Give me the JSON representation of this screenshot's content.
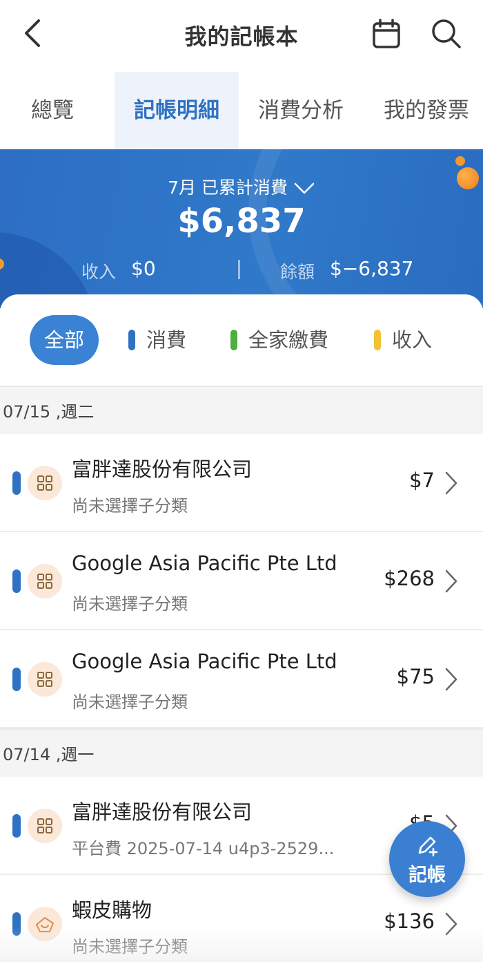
{
  "header": {
    "title": "我的記帳本",
    "back_icon": "chevron-left-icon",
    "calendar_icon": "calendar-icon",
    "search_icon": "search-icon"
  },
  "tabs": [
    {
      "label": "總覽",
      "active": false
    },
    {
      "label": "記帳明細",
      "active": true
    },
    {
      "label": "消費分析",
      "active": false
    },
    {
      "label": "我的發票",
      "active": false
    }
  ],
  "summary": {
    "month_label": "7月 已累計消費",
    "total": "$6,837",
    "income_label": "收入",
    "income_value": "$0",
    "balance_label": "餘額",
    "balance_value": "$−6,837"
  },
  "filters": {
    "all": "全部",
    "items": [
      {
        "label": "消費",
        "color": "#2f72c4"
      },
      {
        "label": "全家繳費",
        "color": "#4caf3f"
      },
      {
        "label": "收入",
        "color": "#f2c230"
      }
    ]
  },
  "groups": [
    {
      "date": "07/15 ,週二",
      "entries": [
        {
          "title": "富胖達股份有限公司",
          "sub": "尚未選擇子分類",
          "amount": "$7",
          "icon": "category-grid-icon"
        },
        {
          "title": "Google Asia Pacific Pte Ltd",
          "sub": "尚未選擇子分類",
          "amount": "$268",
          "icon": "category-grid-icon"
        },
        {
          "title": "Google Asia Pacific Pte Ltd",
          "sub": "尚未選擇子分類",
          "amount": "$75",
          "icon": "category-grid-icon"
        }
      ]
    },
    {
      "date": "07/14 ,週一",
      "entries": [
        {
          "title": "富胖達股份有限公司",
          "sub": "平台費 2025-07-14 u4p3-2529...",
          "amount": "$5",
          "icon": "category-grid-icon"
        },
        {
          "title": "蝦皮購物",
          "sub": "尚未選擇子分類",
          "amount": "$136",
          "icon": "shopping-bag-icon"
        }
      ]
    }
  ],
  "fab": {
    "label": "記帳",
    "icon": "edit-pen-icon"
  }
}
